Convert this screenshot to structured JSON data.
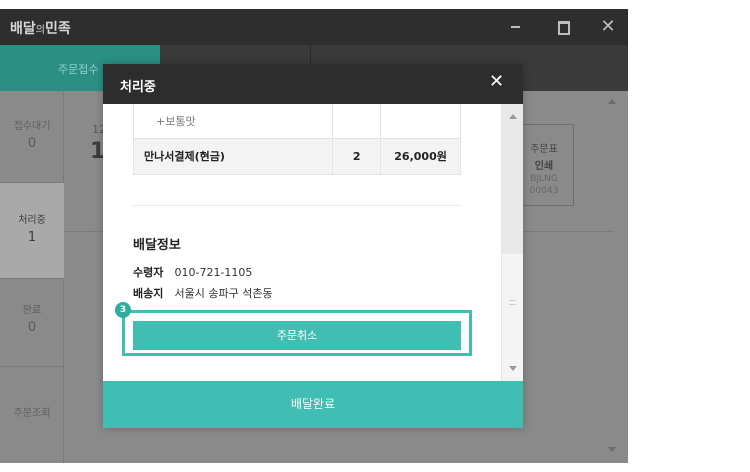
{
  "window": {
    "title_main": "배달",
    "title_small": "의",
    "title_end": "민족",
    "close_glyph": "✕"
  },
  "topbar": {
    "tab_active_label": "주문접수"
  },
  "sidebar": {
    "items": [
      {
        "label": "접수대기",
        "count": "0"
      },
      {
        "label": "처리중",
        "count": "1"
      },
      {
        "label": "완료",
        "count": "0"
      },
      {
        "label": "주문조회",
        "count": ""
      }
    ]
  },
  "main": {
    "order_num_partial": "12",
    "order_big_partial": "1",
    "print_button": {
      "line1": "주문표",
      "line2": "인쇄",
      "line3a": "BJLNG",
      "line3b": "00043"
    }
  },
  "modal": {
    "title": "처리중",
    "close_glyph": "✕",
    "order_items": [
      {
        "name": "+보통맛",
        "qty": "",
        "price": "",
        "type": "option"
      },
      {
        "name": "만나서결제(현금)",
        "qty": "2",
        "price": "26,000원",
        "type": "item"
      }
    ],
    "delivery": {
      "section_title": "배달정보",
      "recipient_label": "수령자",
      "recipient_value": "010-721-1105",
      "address_label": "배송지",
      "address_value": "서울시 송파구 석촌동"
    },
    "cancel_button": "주문취소",
    "step_badge": "3",
    "done_button": "배달완료"
  },
  "colors": {
    "accent": "#41beb3",
    "accent_dark": "#2b8f86",
    "header_dark": "#2d2d2d"
  }
}
